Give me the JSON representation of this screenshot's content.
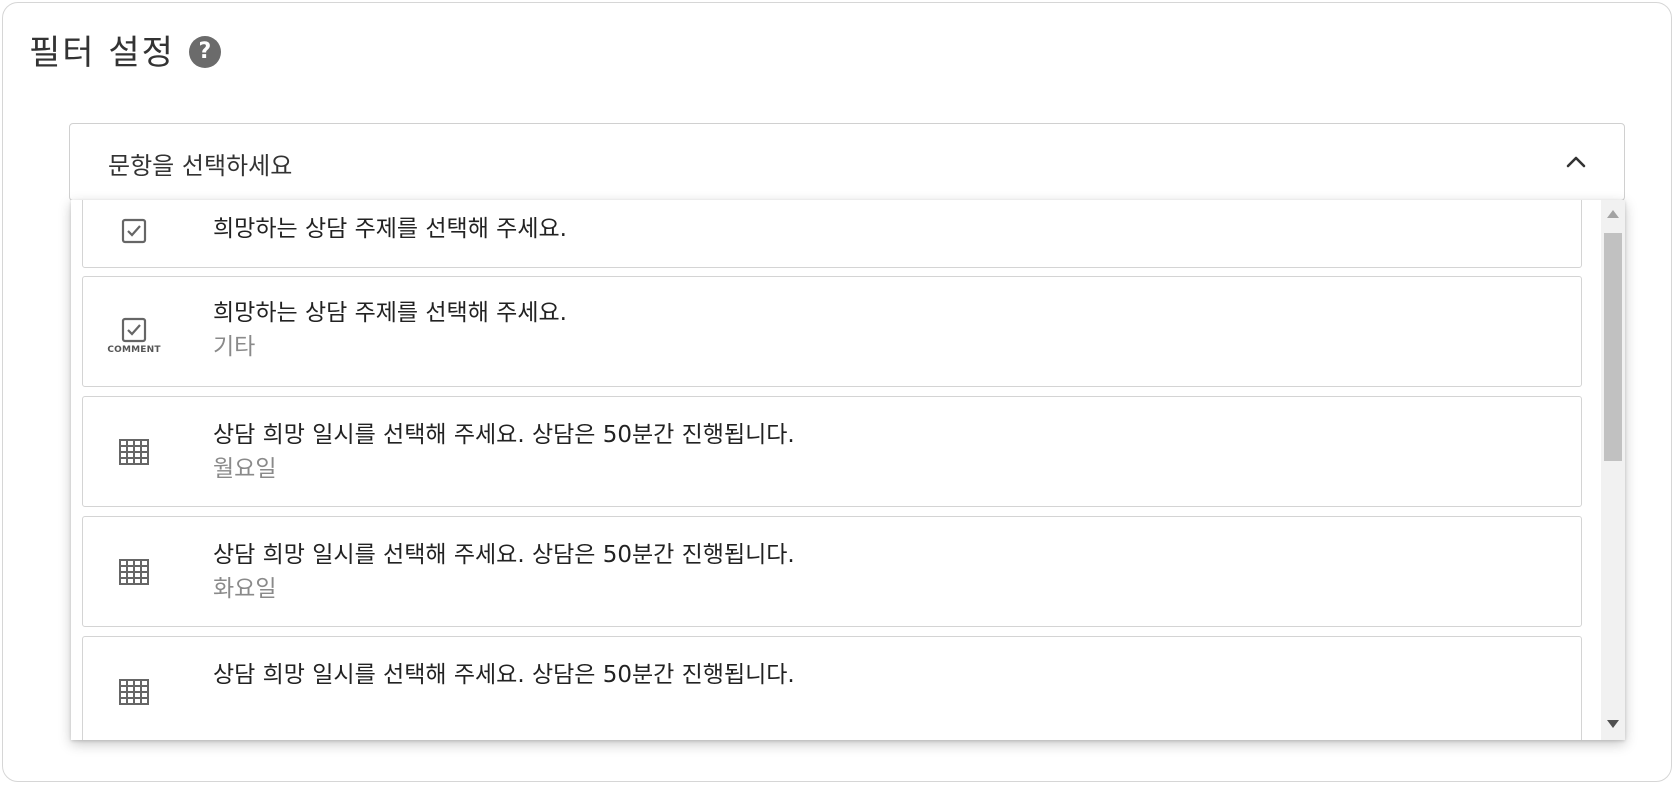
{
  "header": {
    "title": "필터 설정",
    "help_icon": "question-circle-icon"
  },
  "select": {
    "label": "문항을 선택하세요",
    "state_icon": "chevron-up-icon"
  },
  "dropdown": {
    "items": [
      {
        "icon": "checkbox-icon",
        "caption": "",
        "question": "희망하는 상담 주제를 선택해 주세요.",
        "sub": ""
      },
      {
        "icon": "checkbox-comment-icon",
        "caption": "COMMENT",
        "question": "희망하는 상담 주제를 선택해 주세요.",
        "sub": "기타"
      },
      {
        "icon": "grid-icon",
        "caption": "",
        "question": "상담 희망 일시를 선택해 주세요. 상담은 50분간 진행됩니다.",
        "sub": "월요일"
      },
      {
        "icon": "grid-icon",
        "caption": "",
        "question": "상담 희망 일시를 선택해 주세요. 상담은 50분간 진행됩니다.",
        "sub": "화요일"
      },
      {
        "icon": "grid-icon",
        "caption": "",
        "question": "상담 희망 일시를 선택해 주세요. 상담은 50분간 진행됩니다.",
        "sub": ""
      }
    ]
  }
}
